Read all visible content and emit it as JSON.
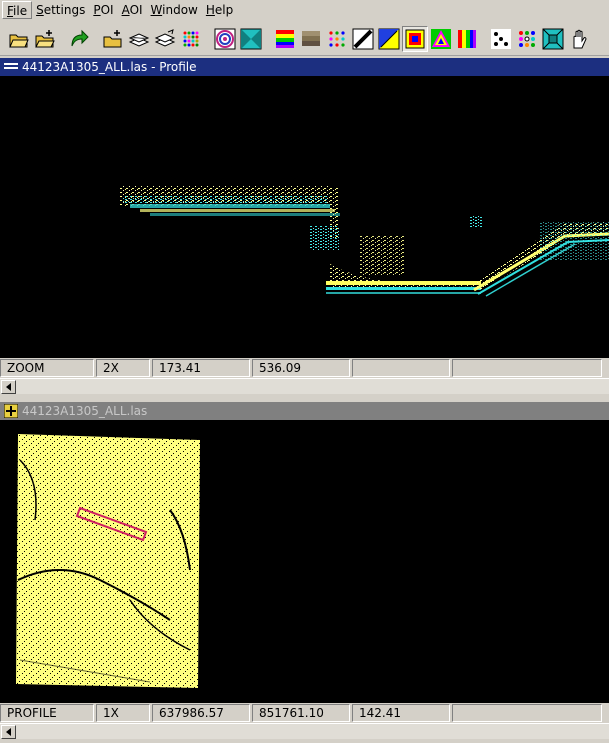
{
  "menu": {
    "items": [
      {
        "label": "File"
      },
      {
        "label": "Settings"
      },
      {
        "label": "POI"
      },
      {
        "label": "AOI"
      },
      {
        "label": "Window"
      },
      {
        "label": "Help"
      }
    ]
  },
  "toolbar": {
    "buttons": [
      {
        "icon": "open-folder-icon"
      },
      {
        "icon": "add-folder-icon"
      },
      {
        "icon": "redo-arrow-icon"
      },
      {
        "icon": "add-layer-icon"
      },
      {
        "icon": "layers-icon"
      },
      {
        "icon": "layer-edit-icon"
      },
      {
        "icon": "color-grid-icon"
      },
      {
        "icon": "target-icon"
      },
      {
        "icon": "view-box-icon"
      },
      {
        "icon": "color-bands-icon"
      },
      {
        "icon": "gray-bands-icon"
      },
      {
        "icon": "dot-grid-icon"
      },
      {
        "icon": "diagonal-line-icon"
      },
      {
        "icon": "blue-triangle-icon"
      },
      {
        "icon": "rgb-square-icon"
      },
      {
        "icon": "rainbow-triangle-icon"
      },
      {
        "icon": "color-bars-icon"
      },
      {
        "icon": "dice-icon"
      },
      {
        "icon": "color-dots-icon"
      },
      {
        "icon": "teal-box-icon"
      },
      {
        "icon": "hand-icon"
      }
    ]
  },
  "profile_window": {
    "title": "44123A1305_ALL.las - Profile",
    "status": {
      "mode": "ZOOM",
      "zoom": "2X",
      "x": "173.41",
      "y": "536.09",
      "extra": ""
    }
  },
  "plan_window": {
    "title": "44123A1305_ALL.las",
    "status": {
      "mode": "PROFILE",
      "zoom": "1X",
      "x": "637986.57",
      "y": "851761.10",
      "z": "142.41"
    }
  },
  "colors": {
    "title_active": "#1c2f80",
    "title_inactive": "#808080",
    "points_yellow": "#ffff80",
    "points_cyan": "#40e0e0",
    "aoi_outline": "#d02060"
  }
}
